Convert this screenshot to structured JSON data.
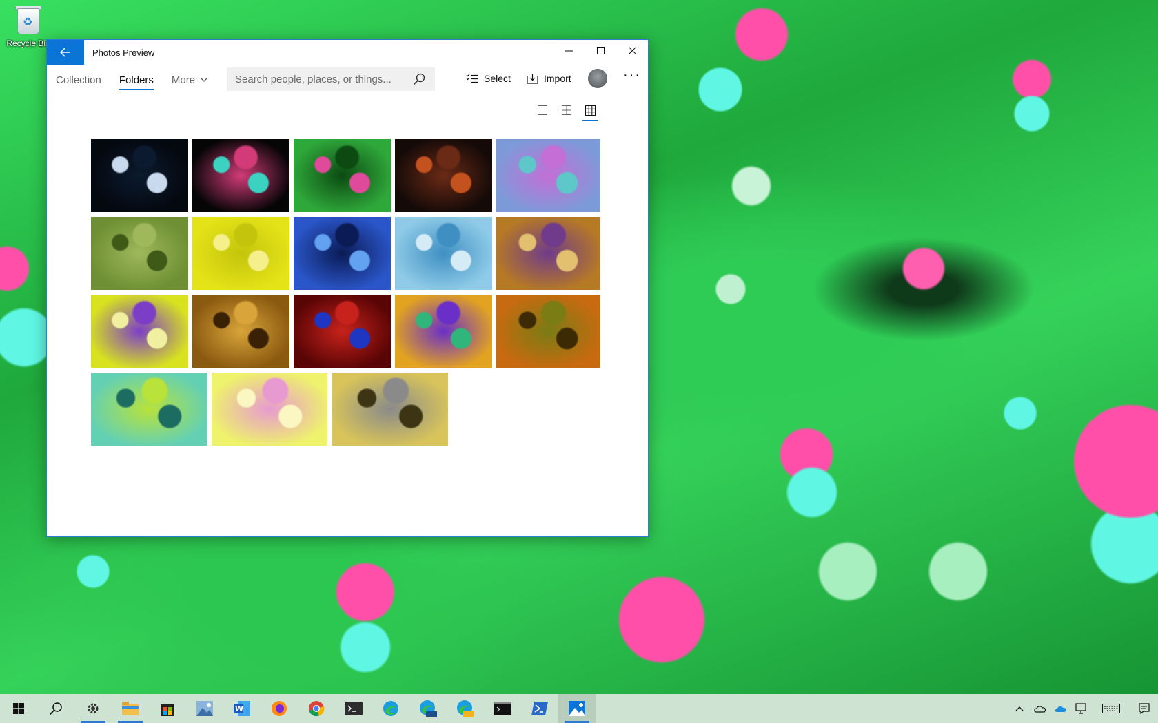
{
  "desktop": {
    "recycle_bin_label": "Recycle Bin"
  },
  "window": {
    "title": "Photos Preview",
    "back_icon": "arrow-left-icon",
    "caption": {
      "minimize_icon": "minimize-icon",
      "maximize_icon": "maximize-icon",
      "close_icon": "close-icon"
    }
  },
  "nav": {
    "tabs": [
      {
        "label": "Collection",
        "active": false
      },
      {
        "label": "Folders",
        "active": true
      }
    ],
    "more_label": "More"
  },
  "search": {
    "placeholder": "Search people, places, or things..."
  },
  "commands": {
    "select_label": "Select",
    "import_label": "Import"
  },
  "view_modes": [
    {
      "name": "large",
      "icon": "single-square-icon",
      "active": false
    },
    {
      "name": "medium",
      "icon": "four-square-grid-icon",
      "active": false
    },
    {
      "name": "small",
      "icon": "nine-square-grid-icon",
      "active": true
    }
  ],
  "accent_color": "#0b74d7",
  "photos": [
    {
      "colors": [
        "#04080f",
        "#0b1a2e",
        "#c9d9ee"
      ]
    },
    {
      "colors": [
        "#050505",
        "#d23b78",
        "#3bd2c2"
      ]
    },
    {
      "colors": [
        "#2fa83a",
        "#0c4a12",
        "#e04a9a"
      ]
    },
    {
      "colors": [
        "#140a08",
        "#6b2a16",
        "#c4521e"
      ]
    },
    {
      "colors": [
        "#7d9ad8",
        "#c36fd6",
        "#5ec7c9"
      ]
    },
    {
      "colors": [
        "#6e8f33",
        "#9fb85c",
        "#3f5a17"
      ]
    },
    {
      "colors": [
        "#e4e318",
        "#c4c40c",
        "#f5f08c"
      ]
    },
    {
      "colors": [
        "#2a56c9",
        "#0b1b55",
        "#63a2f0"
      ]
    },
    {
      "colors": [
        "#8fcbe8",
        "#3f8fc2",
        "#d5ecf7"
      ]
    },
    {
      "colors": [
        "#b77a24",
        "#6f3b8a",
        "#e2c070"
      ]
    },
    {
      "colors": [
        "#d8e21f",
        "#7c3ec7",
        "#f0f0a0"
      ]
    },
    {
      "colors": [
        "#8a5a10",
        "#d9a43a",
        "#3a2005"
      ]
    },
    {
      "colors": [
        "#5a0505",
        "#c8221c",
        "#1e36c2"
      ]
    },
    {
      "colors": [
        "#e2a320",
        "#6a2fc8",
        "#30b67a"
      ]
    },
    {
      "colors": [
        "#c86a10",
        "#7a7c14",
        "#3c2a05"
      ]
    },
    {
      "colors": [
        "#63d0b4",
        "#b9e23a",
        "#1c6c62"
      ]
    },
    {
      "colors": [
        "#eef26c",
        "#e79ad0",
        "#fbf7c2"
      ]
    },
    {
      "colors": [
        "#d8c45a",
        "#8a8a8a",
        "#3c3412"
      ]
    }
  ],
  "taskbar": {
    "items": [
      {
        "icon": "windows-start-icon",
        "open": false,
        "active": false
      },
      {
        "icon": "search-icon",
        "open": false,
        "active": false
      },
      {
        "icon": "settings-gear-icon",
        "open": true,
        "active": false
      },
      {
        "icon": "file-explorer-icon",
        "open": true,
        "active": false
      },
      {
        "icon": "store-icon",
        "open": false,
        "active": false
      },
      {
        "icon": "photos-image-icon",
        "open": false,
        "active": false
      },
      {
        "icon": "word-icon",
        "open": false,
        "active": false
      },
      {
        "icon": "firefox-icon",
        "open": false,
        "active": false
      },
      {
        "icon": "chrome-icon",
        "open": false,
        "active": false
      },
      {
        "icon": "terminal-icon",
        "open": false,
        "active": false
      },
      {
        "icon": "edge-icon",
        "open": false,
        "active": false
      },
      {
        "icon": "edge-beta-icon",
        "open": false,
        "active": false
      },
      {
        "icon": "edge-canary-icon",
        "open": false,
        "active": false
      },
      {
        "icon": "command-prompt-icon",
        "open": false,
        "active": false
      },
      {
        "icon": "powershell-icon",
        "open": false,
        "active": false
      },
      {
        "icon": "photos-app-icon",
        "open": true,
        "active": true
      }
    ],
    "tray": [
      {
        "icon": "chevron-up-icon"
      },
      {
        "icon": "onedrive-outline-icon"
      },
      {
        "icon": "onedrive-icon"
      },
      {
        "icon": "network-icon"
      },
      {
        "icon": "keyboard-icon"
      },
      {
        "icon": "notifications-icon"
      }
    ]
  }
}
